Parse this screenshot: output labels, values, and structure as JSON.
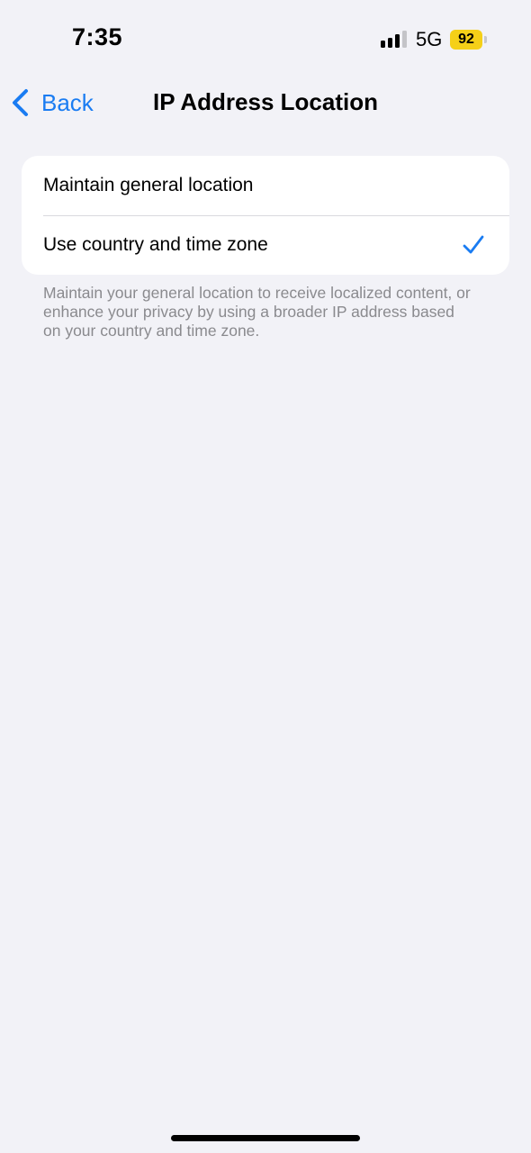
{
  "status_bar": {
    "time": "7:35",
    "network": "5G",
    "battery_level": "92",
    "battery_color": "#f5d018",
    "signal_bars_active": 3,
    "signal_bars_total": 4
  },
  "nav": {
    "back_label": "Back",
    "back_icon": "chevron-left-icon",
    "title": "IP Address Location"
  },
  "options": [
    {
      "label": "Maintain general location",
      "selected": false
    },
    {
      "label": "Use country and time zone",
      "selected": true
    }
  ],
  "footnote": "Maintain your general location to receive localized content, or enhance your privacy by using a broader IP address based on your country and time zone.",
  "colors": {
    "accent": "#1a7cf2",
    "background": "#f2f2f7",
    "secondary_text": "#8a8a8e"
  },
  "icons": {
    "checkmark": "checkmark-icon"
  }
}
